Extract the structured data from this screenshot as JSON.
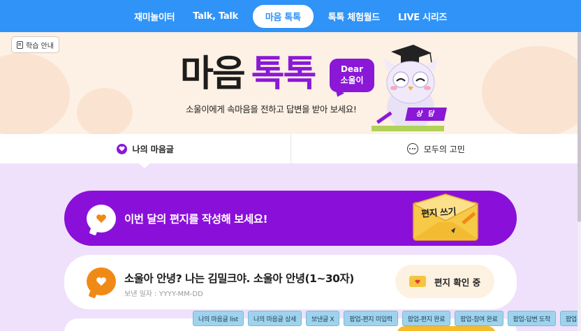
{
  "nav": {
    "items": [
      {
        "label": "재미놀이터",
        "active": false
      },
      {
        "label": "Talk, Talk",
        "active": false
      },
      {
        "label": "마음 톡톡",
        "active": true
      },
      {
        "label": "톡톡 체험월드",
        "active": false
      },
      {
        "label": "LIVE 시리즈",
        "active": false
      }
    ]
  },
  "hero": {
    "guide_label": "학습 안내",
    "title_part1": "마음",
    "title_part2": "톡톡",
    "dear_line1": "Dear",
    "dear_line2": "소울이",
    "subtitle": "소울이에게 속마음을 전하고 답변을 받아 보세요!",
    "counsel_tag": "상 담"
  },
  "tabs": [
    {
      "label": "나의 마음글",
      "icon": "heart-icon",
      "active": true
    },
    {
      "label": "모두의 고민",
      "icon": "chat-bubble-icon",
      "active": false
    }
  ],
  "banner": {
    "text": "이번 달의 편지를 작성해 보세요!",
    "write_button": "편지 쓰기"
  },
  "letter": {
    "title": "소울아 안녕? 나는 김밀크야. 소울아 안녕(1~30자)",
    "date": "보낸 일자 : YYYY-MM-DD",
    "status": "편지 확인 중"
  },
  "dev_buttons": [
    "나의 마음글 list",
    "나의 마음글 상세",
    "보낸글 X",
    "팝업-편지 미입력",
    "팝업-편지 완료",
    "팝업-참여 완료",
    "팝업-답변 도착",
    "팝업-답변 없음"
  ],
  "colors": {
    "nav_bg": "#2f93f7",
    "brand_purple": "#8a10d9",
    "orange": "#f08a16",
    "page_bg": "#efe1fb",
    "hero_bg": "#fdf0e4"
  }
}
